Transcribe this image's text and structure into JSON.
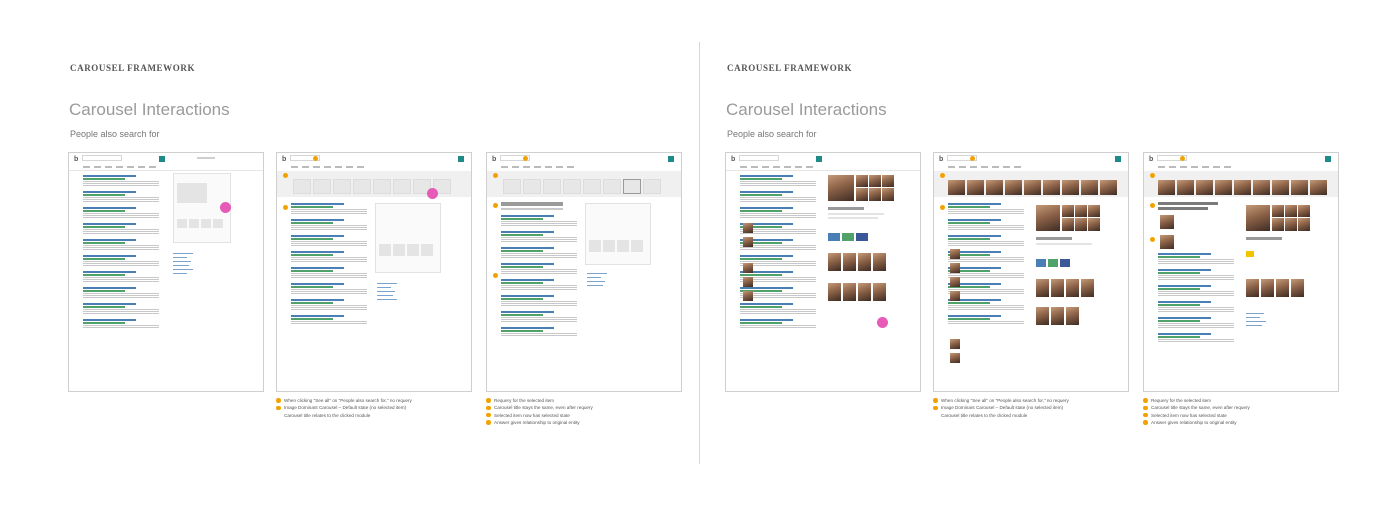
{
  "panels": [
    {
      "eyebrow": "CAROUSEL FRAMEWORK",
      "title": "Carousel Interactions",
      "subtitle": "People also search for",
      "notes_middle": [
        "When clicking \"See all\" on \"People also search for,\" no requery",
        "Image Dominant Carousel – Default state (no selected item)",
        "Carousel title relates to the clicked module"
      ],
      "notes_right": [
        "Requery for the selected item",
        "Carousel title stays the same, even after requery",
        "Selected item now has selected state",
        "Answer gives relationship to original entity"
      ]
    },
    {
      "eyebrow": "CAROUSEL FRAMEWORK",
      "title": "Carousel Interactions",
      "subtitle": "People also search for",
      "notes_middle": [
        "When clicking \"See all\" on \"People also search for,\" no requery",
        "Image Dominant Carousel – Default state (no selected item)",
        "Carousel title relates to the clicked module"
      ],
      "notes_right": [
        "Requery for the selected item",
        "Carousel title stays the same, even after requery",
        "Selected item now has selected state",
        "Answer gives relationship to original entity"
      ]
    }
  ],
  "colors": {
    "accent": "#f2a200",
    "brand_teal": "#1e8a8a",
    "link_blue": "#4a7fb5",
    "url_green": "#4fa36a",
    "highlight_pink": "#e65bb8"
  },
  "icons": [
    "bing-logo-icon",
    "search-button-icon",
    "numbered-callout-icon",
    "pink-click-indicator-icon"
  ]
}
